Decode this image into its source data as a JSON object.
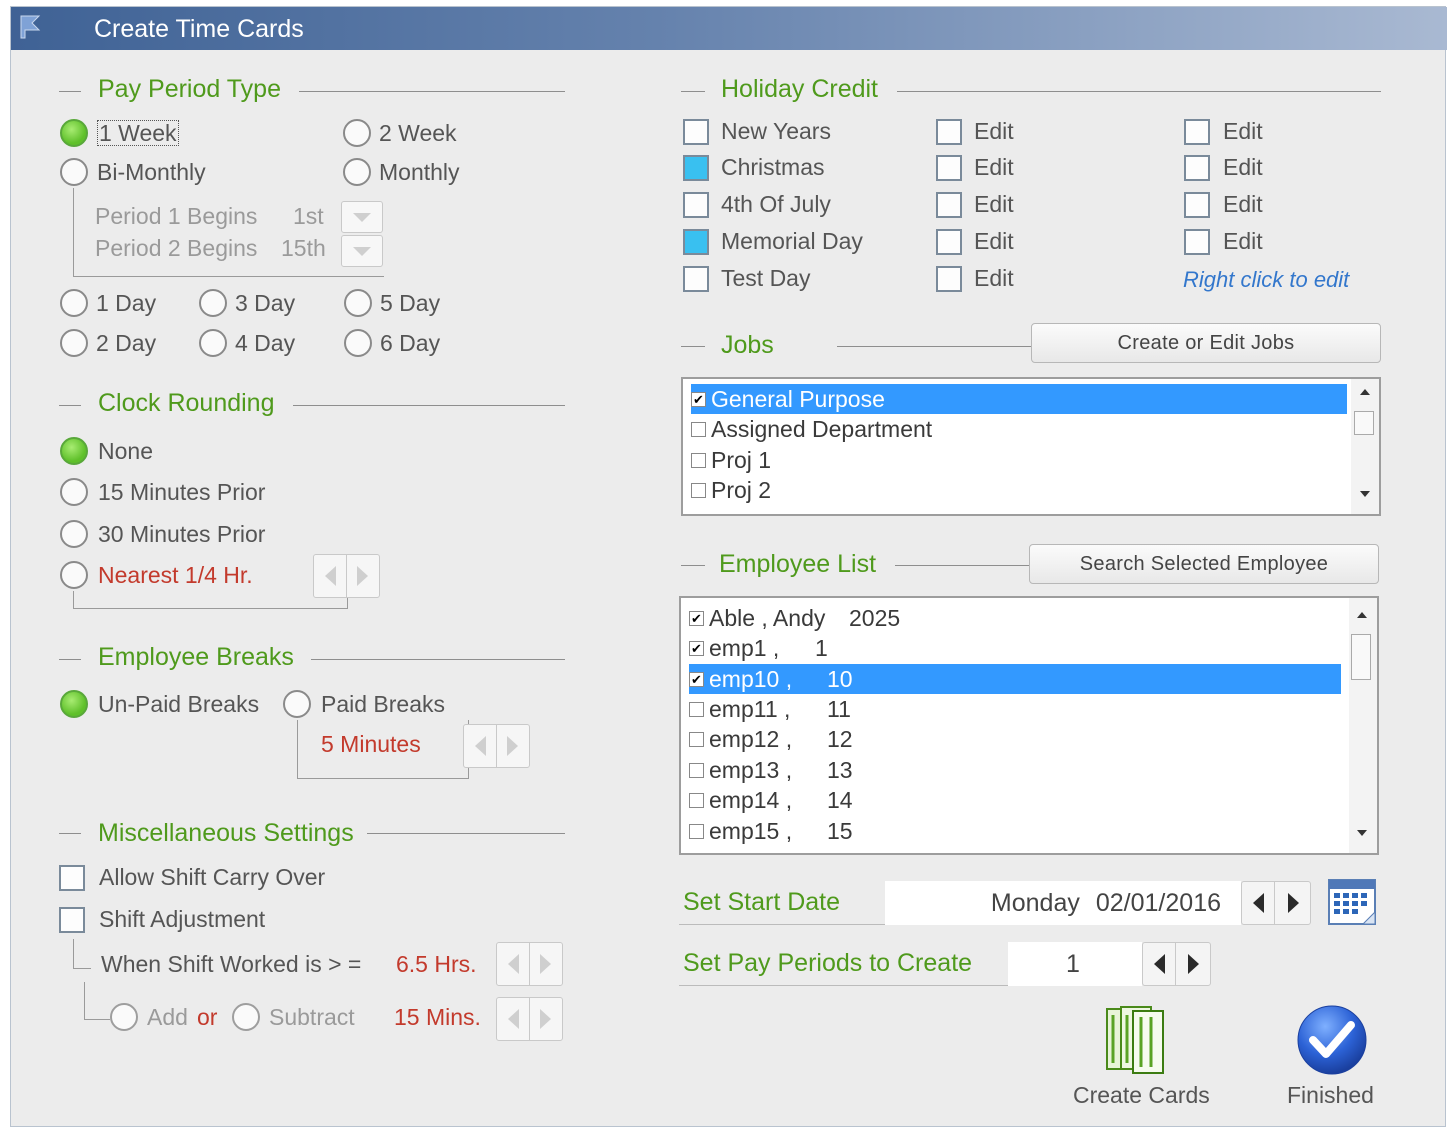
{
  "window": {
    "title": "Create Time Cards"
  },
  "pay_period": {
    "title": "Pay Period Type",
    "options": [
      {
        "label": "1 Week",
        "selected": true
      },
      {
        "label": "2 Week",
        "selected": false
      },
      {
        "label": "Bi-Monthly",
        "selected": false
      },
      {
        "label": "Monthly",
        "selected": false
      }
    ],
    "period1_label": "Period 1 Begins",
    "period1_value": "1st",
    "period2_label": "Period 2 Begins",
    "period2_value": "15th",
    "days": [
      "1 Day",
      "3 Day",
      "5 Day",
      "2 Day",
      "4 Day",
      "6 Day"
    ]
  },
  "clock_rounding": {
    "title": "Clock Rounding",
    "options": [
      {
        "label": "None",
        "selected": true
      },
      {
        "label": "15 Minutes Prior",
        "selected": false
      },
      {
        "label": "30 Minutes Prior",
        "selected": false
      },
      {
        "label": "Nearest 1/4 Hr.",
        "selected": false
      }
    ]
  },
  "breaks": {
    "title": "Employee Breaks",
    "unpaid": "Un-Paid Breaks",
    "paid": "Paid Breaks",
    "minutes": "5 Minutes"
  },
  "misc": {
    "title": "Miscellaneous Settings",
    "carry_over": "Allow Shift Carry Over",
    "adjustment": "Shift Adjustment",
    "worked_label": "When Shift Worked is > =",
    "worked_value": "6.5 Hrs.",
    "add": "Add",
    "or": "or",
    "subtract": "Subtract",
    "mins_value": "15 Mins."
  },
  "holiday": {
    "title": "Holiday Credit",
    "items": [
      {
        "label": "New Years",
        "checked": false
      },
      {
        "label": "Christmas",
        "checked": true
      },
      {
        "label": "4th Of July",
        "checked": false
      },
      {
        "label": "Memorial Day",
        "checked": true
      },
      {
        "label": "Test Day",
        "checked": false
      }
    ],
    "edit": "Edit",
    "right_click": "Right click to edit"
  },
  "jobs": {
    "title": "Jobs",
    "button": "Create or Edit Jobs",
    "items": [
      {
        "label": "General Purpose",
        "checked": true,
        "selected": true
      },
      {
        "label": "Assigned Department",
        "checked": false,
        "selected": false
      },
      {
        "label": "Proj 1",
        "checked": false,
        "selected": false
      },
      {
        "label": "Proj 2",
        "checked": false,
        "selected": false
      }
    ]
  },
  "employees": {
    "title": "Employee List",
    "button": "Search Selected Employee",
    "items": [
      {
        "name": "Able , Andy",
        "id": "2025",
        "checked": true,
        "selected": false
      },
      {
        "name": "emp1 ,",
        "id": "1",
        "checked": true,
        "selected": false
      },
      {
        "name": "emp10 ,",
        "id": "10",
        "checked": true,
        "selected": true
      },
      {
        "name": "emp11 ,",
        "id": "11",
        "checked": false,
        "selected": false
      },
      {
        "name": "emp12 ,",
        "id": "12",
        "checked": false,
        "selected": false
      },
      {
        "name": "emp13 ,",
        "id": "13",
        "checked": false,
        "selected": false
      },
      {
        "name": "emp14 ,",
        "id": "14",
        "checked": false,
        "selected": false
      },
      {
        "name": "emp15 ,",
        "id": "15",
        "checked": false,
        "selected": false
      }
    ]
  },
  "start_date": {
    "label": "Set Start Date",
    "day": "Monday",
    "date": "02/01/2016"
  },
  "pay_periods": {
    "label": "Set Pay Periods to Create",
    "value": "1"
  },
  "actions": {
    "create": "Create Cards",
    "finished": "Finished"
  },
  "colors": {
    "accent_green": "#4f9a1c",
    "selection_blue": "#3399ff",
    "red_text": "#c33a2c"
  }
}
